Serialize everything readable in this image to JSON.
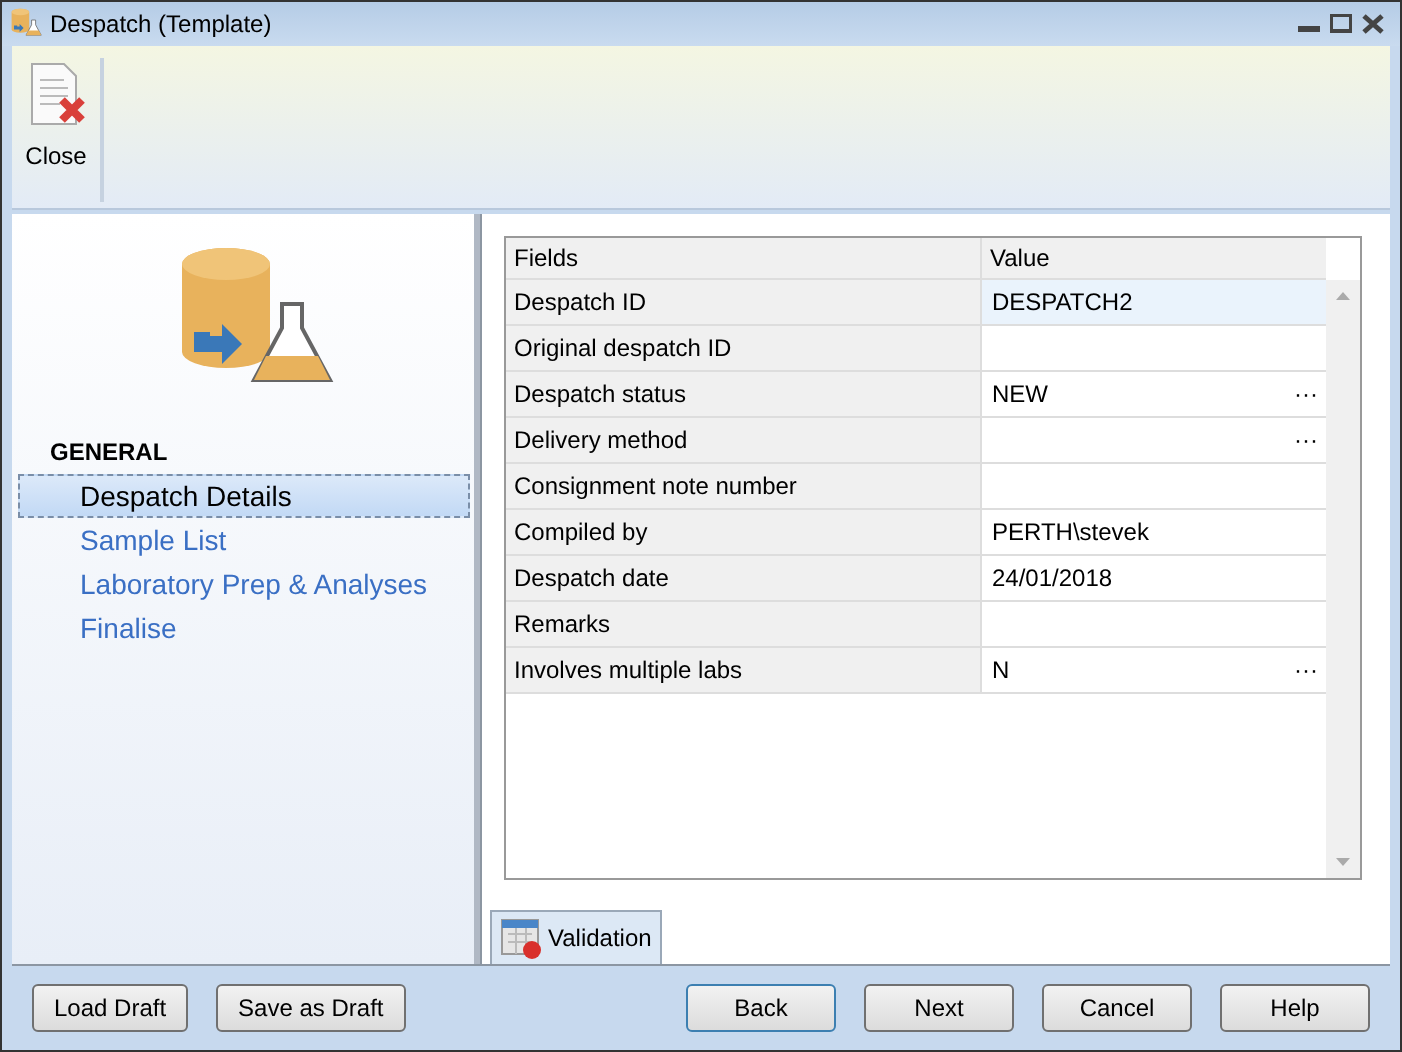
{
  "window": {
    "title": "Despatch (Template)"
  },
  "ribbon": {
    "close_label": "Close"
  },
  "sidebar": {
    "heading": "GENERAL",
    "items": [
      {
        "label": "Despatch Details",
        "selected": true
      },
      {
        "label": "Sample List",
        "selected": false
      },
      {
        "label": "Laboratory Prep & Analyses",
        "selected": false
      },
      {
        "label": "Finalise",
        "selected": false
      }
    ]
  },
  "grid": {
    "columns": [
      "Fields",
      "Value"
    ],
    "rows": [
      {
        "field": "Despatch ID",
        "value": "DESPATCH2",
        "selected": true
      },
      {
        "field": "Original despatch ID",
        "selected": false
      },
      {
        "field": "Despatch status",
        "value": "NEW",
        "selected": false,
        "picker_label": "···"
      },
      {
        "field": "Delivery method",
        "selected": false,
        "picker_label": "···"
      },
      {
        "field": "Consignment note number",
        "selected": false
      },
      {
        "field": "Compiled by",
        "value": "PERTH\\stevek",
        "selected": false
      },
      {
        "field": "Despatch date",
        "value": "24/01/2018",
        "selected": false
      },
      {
        "field": "Remarks",
        "selected": false
      },
      {
        "field": "Involves multiple labs",
        "value": "N",
        "selected": false,
        "picker_label": "···"
      }
    ]
  },
  "bottom_tabs": [
    {
      "label": "Validation",
      "selected": true
    }
  ],
  "left_buttons": [
    "Load Draft",
    "Save as Draft"
  ],
  "right_buttons": [
    {
      "label": "Back",
      "default": true
    },
    {
      "label": "Next",
      "default": false
    },
    {
      "label": "Cancel",
      "default": false
    },
    {
      "label": "Help",
      "default": false
    }
  ]
}
